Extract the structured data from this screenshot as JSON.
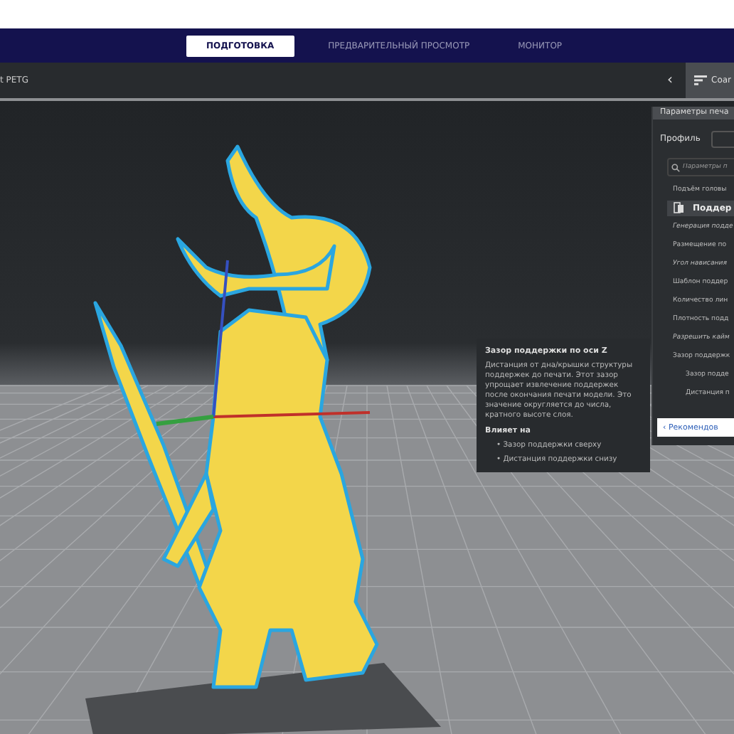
{
  "stages": [
    {
      "label": "ПОДГОТОВКА",
      "selected": true
    },
    {
      "label": "ПРЕДВАРИТЕЛЬНЫЙ ПРОСМОТР",
      "selected": false
    },
    {
      "label": "МОНИТОР",
      "selected": false
    }
  ],
  "toolbar": {
    "material": "t PETG",
    "collapse_glyph": "‹",
    "profile_button": "Coar"
  },
  "settings_panel": {
    "title": "Параметры печа",
    "profile_label": "Профиль",
    "search_placeholder": "Параметры п",
    "items": [
      {
        "label": "Подъём головы",
        "kind": "setting",
        "italic": false
      },
      {
        "label": "Поддер",
        "kind": "category",
        "italic": false
      },
      {
        "label": "Генерация подде",
        "kind": "setting",
        "italic": true
      },
      {
        "label": "Размещение по",
        "kind": "setting",
        "italic": false
      },
      {
        "label": "Угол нависания",
        "kind": "setting",
        "italic": true
      },
      {
        "label": "Шаблон поддер",
        "kind": "setting",
        "italic": false
      },
      {
        "label": "Количество лин",
        "kind": "setting",
        "italic": false
      },
      {
        "label": "Плотность подд",
        "kind": "setting",
        "italic": false
      },
      {
        "label": "Разрешить кайм",
        "kind": "setting",
        "italic": true
      },
      {
        "label": "Зазор поддержк",
        "kind": "setting",
        "italic": false,
        "children": [
          {
            "label": "Зазор подде",
            "kind": "setting",
            "italic": false
          },
          {
            "label": "Дистанция п",
            "kind": "setting",
            "italic": false
          }
        ]
      }
    ],
    "recommended_button": {
      "glyph": "‹",
      "label": "Рекомендов"
    }
  },
  "tooltip": {
    "title": "Зазор поддержки по оси Z",
    "description": "Дистанция от дна/крышки структуры поддержек до печати. Этот зазор упрощает извлечение поддержек после окончания печати модели. Это значение округляется до числа, кратного высоте слоя.",
    "affects_label": "Влияет на",
    "affects": [
      "• Зазор поддержки сверху",
      "• Дистанция поддержки снизу"
    ]
  }
}
